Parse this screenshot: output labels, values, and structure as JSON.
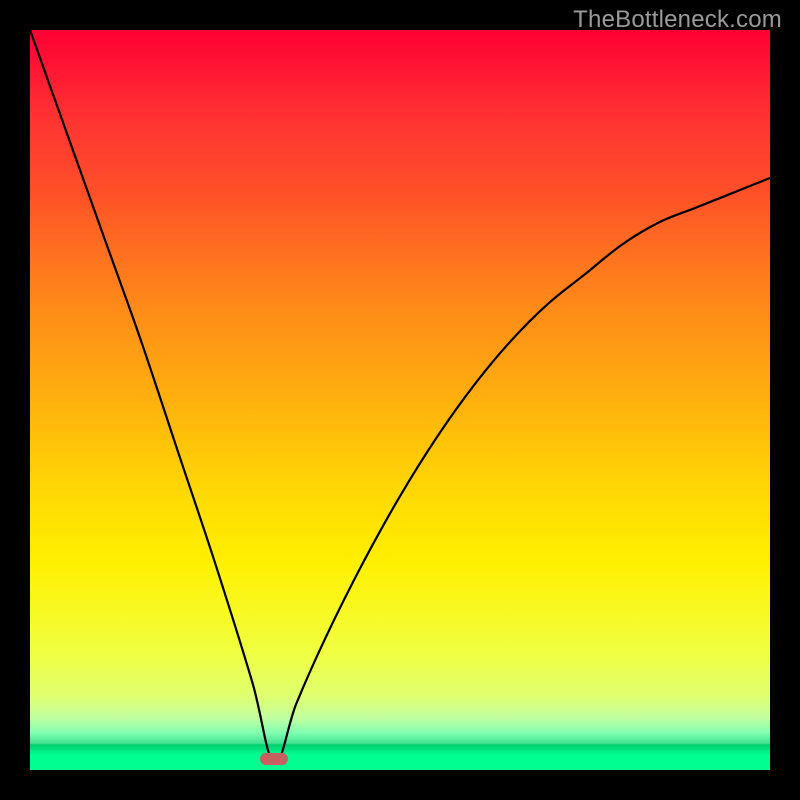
{
  "domain": "Chart",
  "watermark": "TheBottleneck.com",
  "colors": {
    "frame_border": "#000000",
    "curve_stroke": "#000000",
    "marker_fill": "#c66060",
    "gradient_top": "#ff0033",
    "gradient_bottom": "#00ff90"
  },
  "chart_data": {
    "type": "line",
    "title": "",
    "xlabel": "",
    "ylabel": "",
    "xlim": [
      0,
      100
    ],
    "ylim": [
      0,
      100
    ],
    "annotations": [
      {
        "name": "sweet-spot-marker",
        "x": 33,
        "y": 1.5
      }
    ],
    "series": [
      {
        "name": "bottleneck-curve",
        "x": [
          0,
          5,
          10,
          15,
          20,
          25,
          30,
          33,
          36,
          40,
          45,
          50,
          55,
          60,
          65,
          70,
          75,
          80,
          85,
          90,
          95,
          100
        ],
        "values": [
          100,
          86,
          72,
          58,
          43,
          28,
          12,
          1,
          9,
          18,
          28,
          37,
          45,
          52,
          58,
          63,
          67,
          71,
          74,
          76,
          78,
          80
        ]
      }
    ]
  }
}
